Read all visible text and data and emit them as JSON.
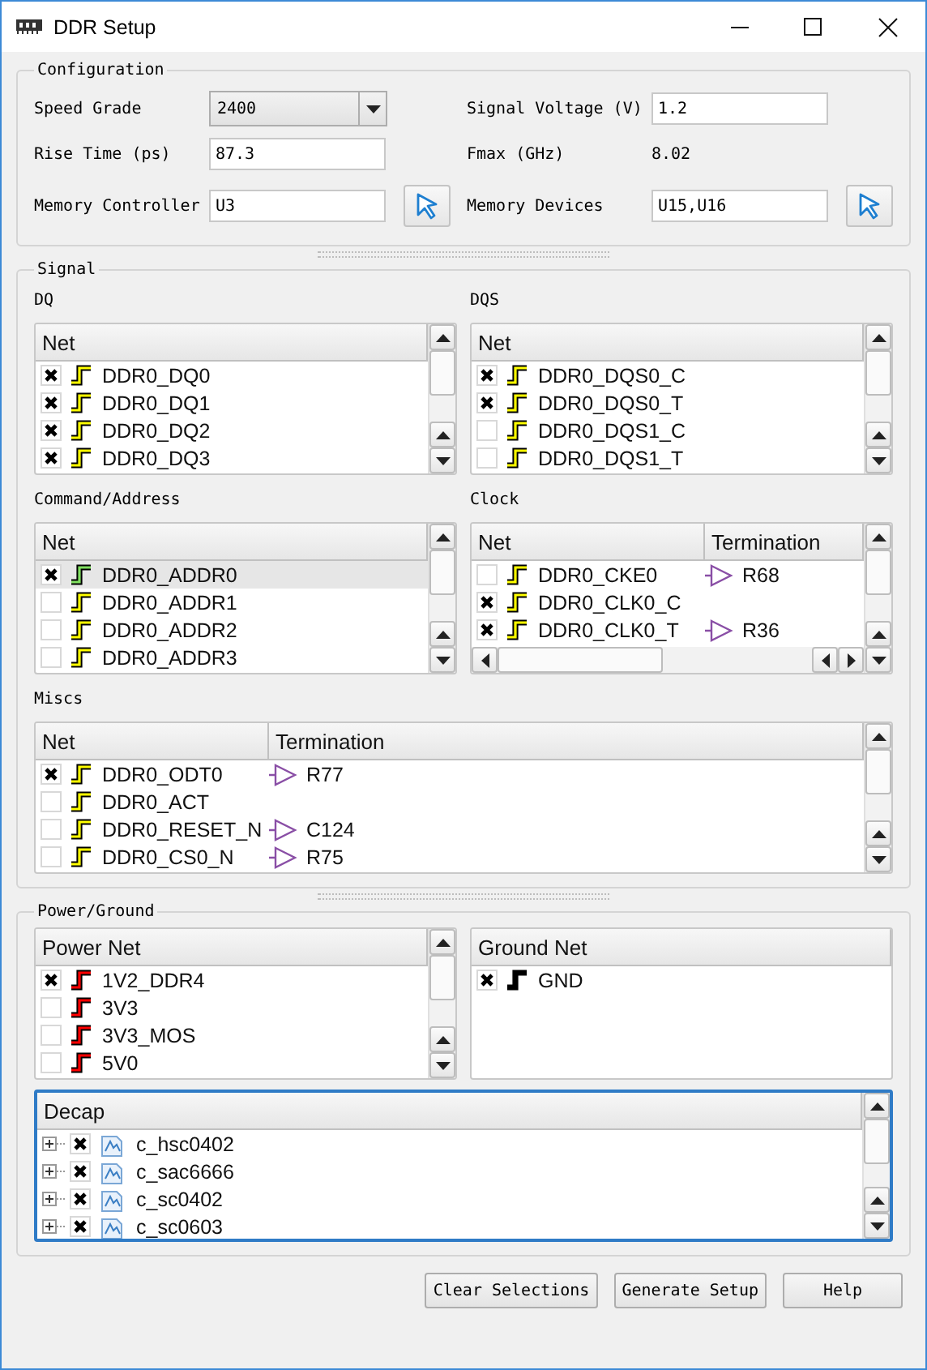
{
  "window": {
    "title": "DDR Setup"
  },
  "configuration": {
    "title": "Configuration",
    "fields": [
      {
        "label": "Speed Grade",
        "kind": "combo",
        "value": "2400"
      },
      {
        "label": "Signal Voltage (V)",
        "kind": "input",
        "value": "1.2"
      },
      {
        "label": "Rise Time (ps)",
        "kind": "input",
        "value": "87.3"
      },
      {
        "label": "Fmax (GHz)",
        "kind": "value",
        "value": "8.02"
      },
      {
        "label": "Memory Controller",
        "kind": "picker",
        "value": "U3"
      },
      {
        "label": "Memory Devices",
        "kind": "picker",
        "value": "U15,U16"
      }
    ]
  },
  "sections": [
    {
      "title": "Signal",
      "lists": [
        {
          "title": "DQ",
          "kind": "table",
          "wide": false,
          "vscroll": true,
          "hscroll": false,
          "focused": false,
          "columns": [
            "Net"
          ],
          "rows": [
            {
              "checked": true,
              "selected": false,
              "name": "DDR0_DQ0",
              "color": "#ffff00"
            },
            {
              "checked": true,
              "selected": false,
              "name": "DDR0_DQ1",
              "color": "#ffff00"
            },
            {
              "checked": true,
              "selected": false,
              "name": "DDR0_DQ2",
              "color": "#ffff00"
            },
            {
              "checked": true,
              "selected": false,
              "name": "DDR0_DQ3",
              "color": "#ffff00"
            }
          ]
        },
        {
          "title": "DQS",
          "kind": "table",
          "wide": false,
          "vscroll": true,
          "hscroll": false,
          "focused": false,
          "columns": [
            "Net"
          ],
          "rows": [
            {
              "checked": true,
              "selected": false,
              "name": "DDR0_DQS0_C",
              "color": "#ffff00"
            },
            {
              "checked": true,
              "selected": false,
              "name": "DDR0_DQS0_T",
              "color": "#ffff00"
            },
            {
              "checked": false,
              "selected": false,
              "name": "DDR0_DQS1_C",
              "color": "#ffff00"
            },
            {
              "checked": false,
              "selected": false,
              "name": "DDR0_DQS1_T",
              "color": "#ffff00"
            }
          ]
        },
        {
          "title": "Command/Address",
          "kind": "table",
          "wide": false,
          "vscroll": true,
          "hscroll": false,
          "focused": false,
          "columns": [
            "Net"
          ],
          "rows": [
            {
              "checked": true,
              "selected": true,
              "name": "DDR0_ADDR0",
              "color": "#80e060"
            },
            {
              "checked": false,
              "selected": false,
              "name": "DDR0_ADDR1",
              "color": "#ffff00"
            },
            {
              "checked": false,
              "selected": false,
              "name": "DDR0_ADDR2",
              "color": "#ffff00"
            },
            {
              "checked": false,
              "selected": false,
              "name": "DDR0_ADDR3",
              "color": "#ffff00"
            }
          ]
        },
        {
          "title": "Clock",
          "kind": "table",
          "wide": false,
          "vscroll": true,
          "hscroll": true,
          "focused": false,
          "columns": [
            "Net",
            "Termination"
          ],
          "rows": [
            {
              "checked": false,
              "selected": false,
              "name": "DDR0_CKE0",
              "color": "#ffff00",
              "termination": "R68"
            },
            {
              "checked": true,
              "selected": false,
              "name": "DDR0_CLK0_C",
              "color": "#ffff00"
            },
            {
              "checked": true,
              "selected": false,
              "name": "DDR0_CLK0_T",
              "color": "#ffff00",
              "termination": "R36"
            }
          ]
        },
        {
          "title": "Miscs",
          "kind": "table",
          "wide": true,
          "vscroll": true,
          "hscroll": false,
          "focused": false,
          "columns": [
            "Net",
            "Termination"
          ],
          "rows": [
            {
              "checked": true,
              "selected": false,
              "name": "DDR0_ODT0",
              "color": "#ffff00",
              "termination": "R77"
            },
            {
              "checked": false,
              "selected": false,
              "name": "DDR0_ACT",
              "color": "#ffff00"
            },
            {
              "checked": false,
              "selected": false,
              "name": "DDR0_RESET_N",
              "color": "#ffff00",
              "termination": "C124"
            },
            {
              "checked": false,
              "selected": false,
              "name": "DDR0_CS0_N",
              "color": "#ffff00",
              "termination": "R75"
            }
          ]
        }
      ]
    },
    {
      "title": "Power/Ground",
      "lists": [
        {
          "kind": "table",
          "wide": false,
          "vscroll": true,
          "hscroll": false,
          "focused": false,
          "columns": [
            "Power Net"
          ],
          "rows": [
            {
              "checked": true,
              "selected": false,
              "name": "1V2_DDR4",
              "color": "#ff0000"
            },
            {
              "checked": false,
              "selected": false,
              "name": "3V3",
              "color": "#ff0000"
            },
            {
              "checked": false,
              "selected": false,
              "name": "3V3_MOS",
              "color": "#ff0000"
            },
            {
              "checked": false,
              "selected": false,
              "name": "5V0",
              "color": "#ff0000"
            }
          ]
        },
        {
          "kind": "table",
          "wide": false,
          "vscroll": false,
          "hscroll": false,
          "focused": false,
          "columns": [
            "Ground Net"
          ],
          "rows": [
            {
              "checked": true,
              "selected": false,
              "name": "GND",
              "color": "#000000"
            }
          ]
        },
        {
          "kind": "tree",
          "wide": true,
          "vscroll": true,
          "hscroll": false,
          "focused": true,
          "columns": [
            "Decap"
          ],
          "rows": [
            {
              "checked": true,
              "selected": false,
              "expanded": false,
              "name": "c_hsc0402"
            },
            {
              "checked": true,
              "selected": false,
              "expanded": false,
              "name": "c_sac6666"
            },
            {
              "checked": true,
              "selected": false,
              "expanded": false,
              "name": "c_sc0402"
            },
            {
              "checked": true,
              "selected": false,
              "expanded": false,
              "name": "c_sc0603"
            }
          ]
        }
      ]
    }
  ],
  "buttons": [
    "Clear Selections",
    "Generate Setup",
    "Help"
  ]
}
